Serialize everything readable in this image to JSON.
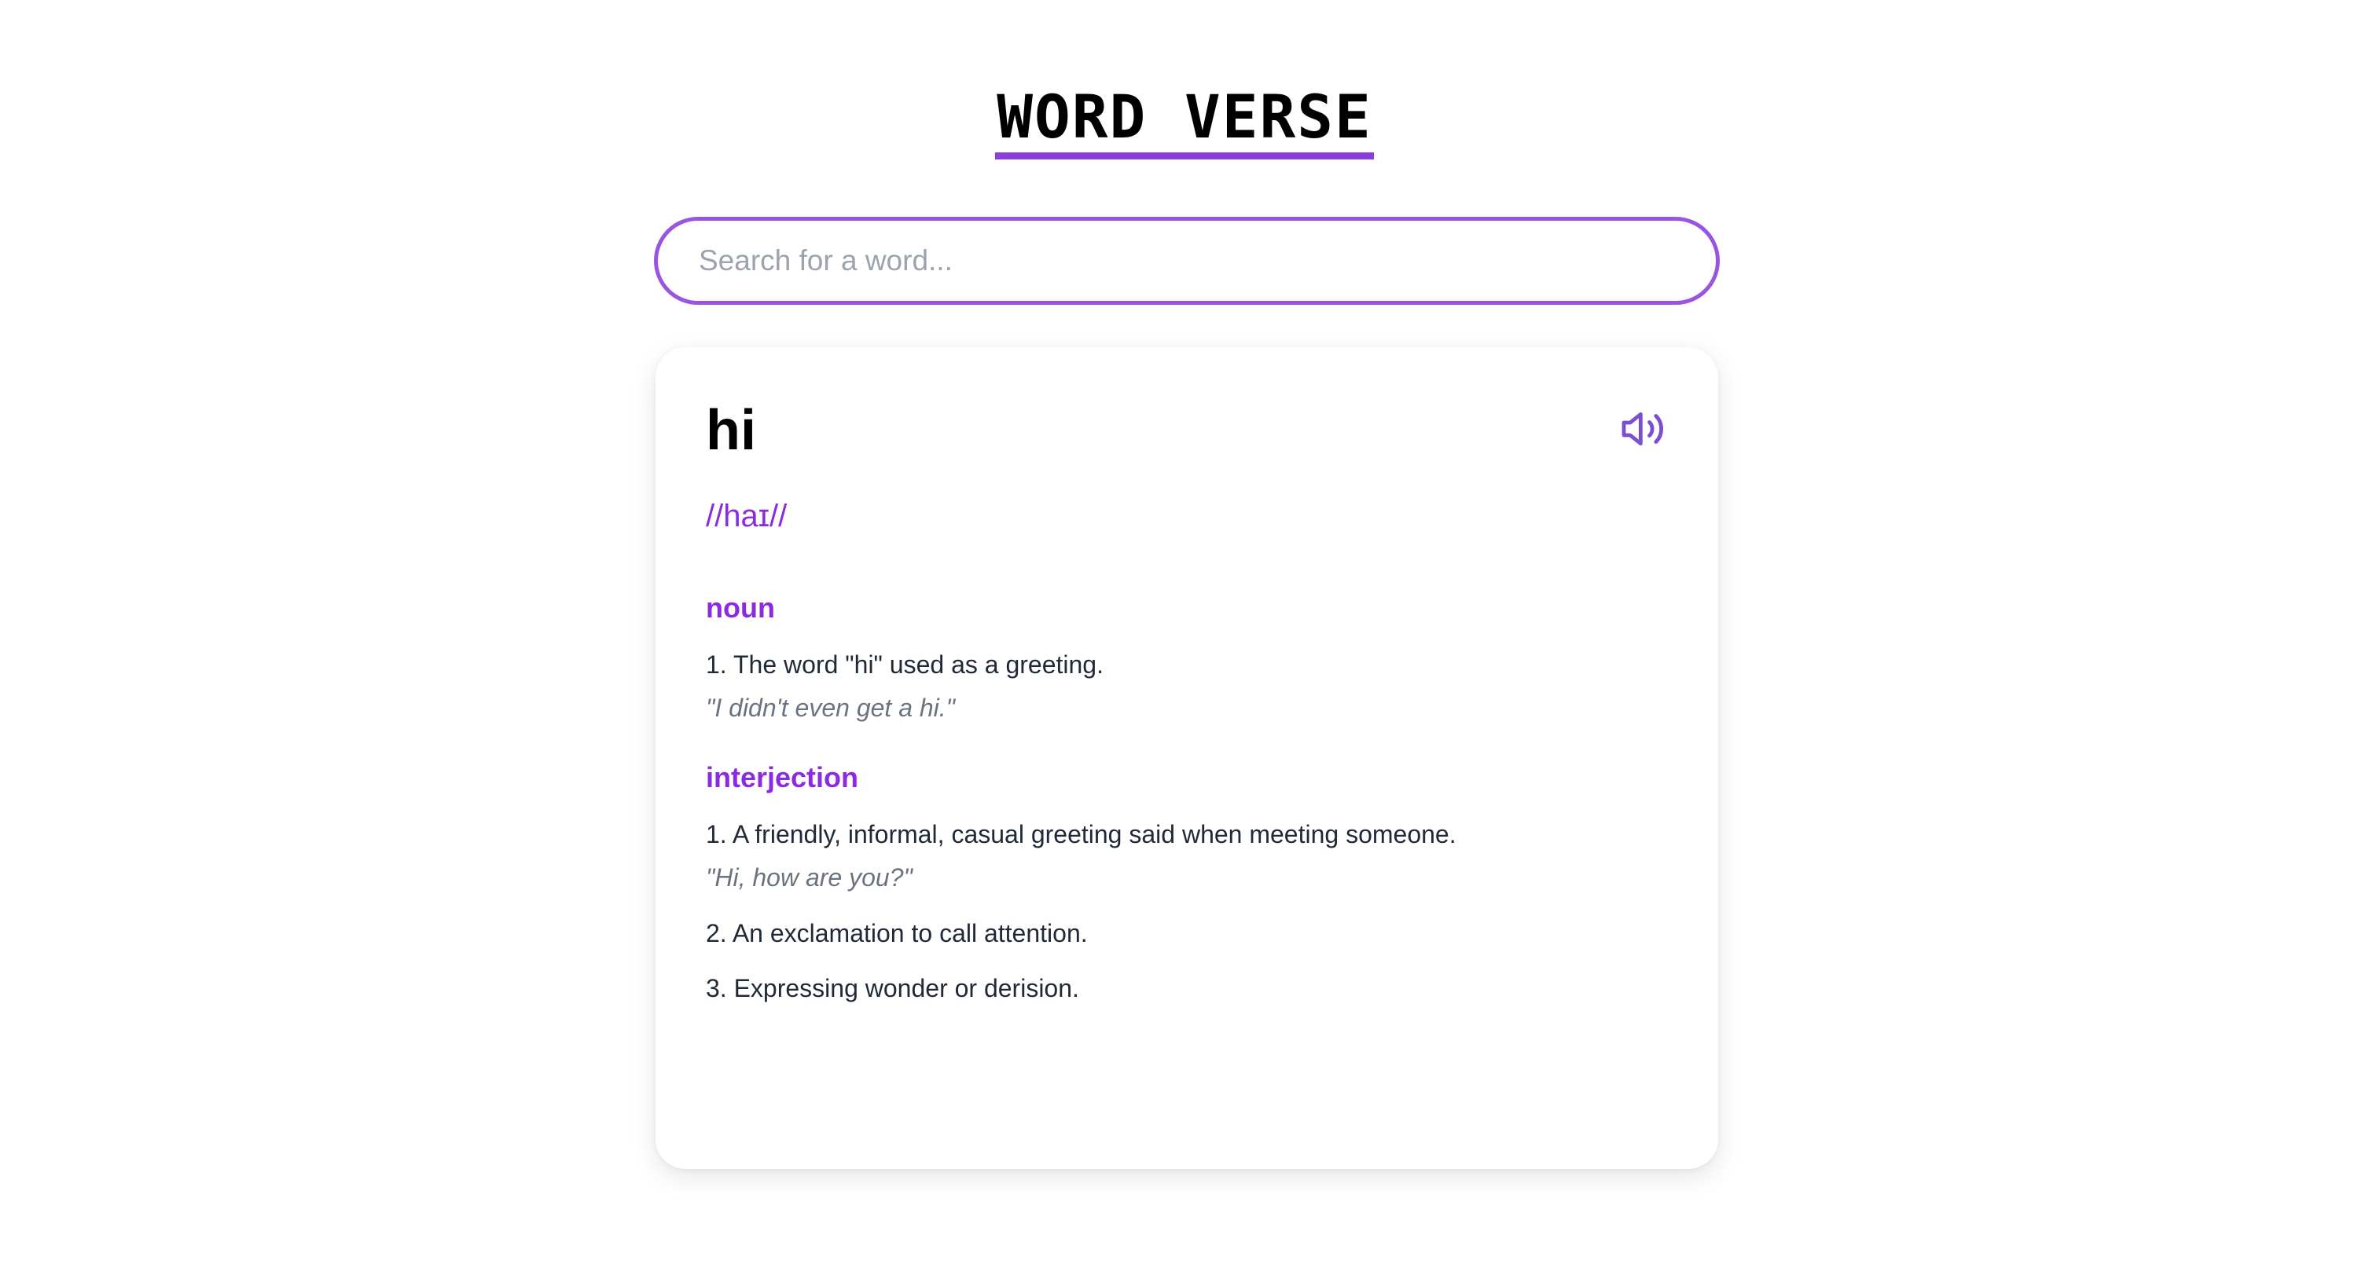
{
  "header": {
    "title": "WORD VERSE"
  },
  "search": {
    "placeholder": "Search for a word...",
    "value": ""
  },
  "result": {
    "word": "hi",
    "phonetic": "//haɪ//",
    "audio_icon": "speaker-volume-icon",
    "meanings": [
      {
        "part_of_speech": "noun",
        "definitions": [
          {
            "text": "1. The word \"hi\" used as a greeting.",
            "example": "\"I didn't even get a hi.\""
          }
        ]
      },
      {
        "part_of_speech": "interjection",
        "definitions": [
          {
            "text": "1. A friendly, informal, casual greeting said when meeting someone.",
            "example": "\"Hi, how are you?\""
          },
          {
            "text": "2. An exclamation to call attention."
          },
          {
            "text": "3. Expressing wonder or derision."
          }
        ]
      }
    ]
  },
  "colors": {
    "accent": "#8a2be2",
    "search_border": "#9a55e0",
    "title_underline": "#8a3fd9",
    "body_text": "#1f2937",
    "example_text": "#6b7280"
  }
}
